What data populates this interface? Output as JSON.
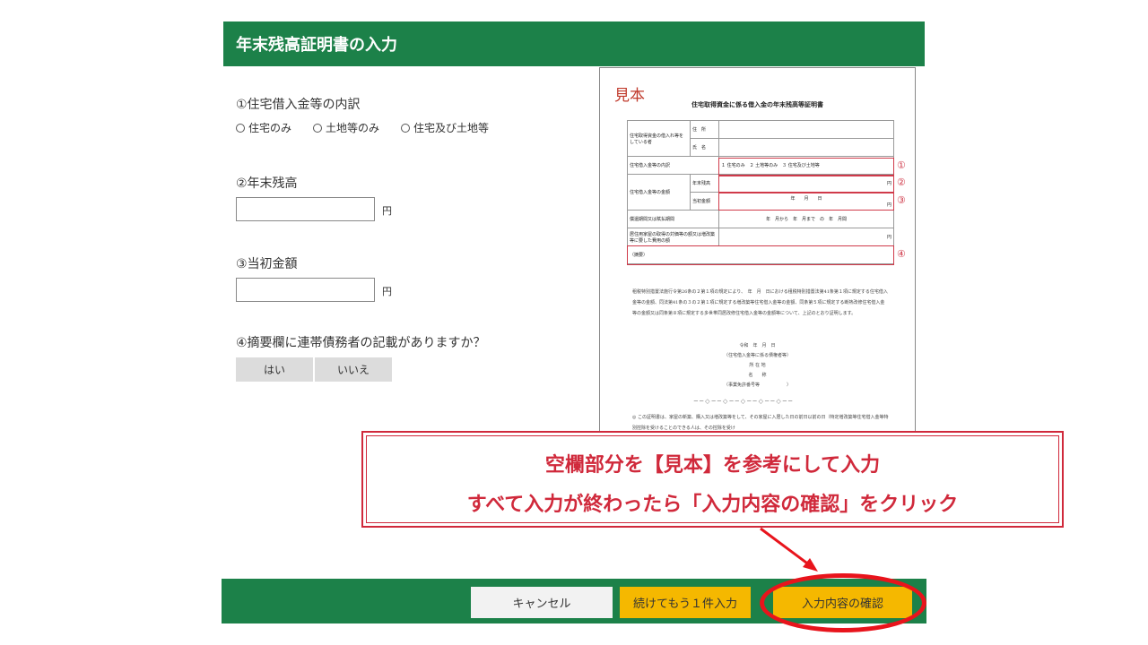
{
  "header": {
    "title": "年末残高証明書の入力"
  },
  "form": {
    "q1_label": "①住宅借入金等の内訳",
    "q1_options": [
      "住宅のみ",
      "土地等のみ",
      "住宅及び土地等"
    ],
    "q2_label": "②年末残高",
    "q3_label": "③当初金額",
    "yen": "円",
    "q4_label": "④摘要欄に連帯債務者の記載がありますか？",
    "yes": "はい",
    "no": "いいえ"
  },
  "sample": {
    "title": "見本",
    "heading": "住宅取得資金に係る借入金の年末残高等証明書",
    "r1_left": "住宅取得資金の借入れ等をしている者",
    "r1_a": "住　所",
    "r1_b": "氏　名",
    "r2_left": "住宅借入金等の内訳",
    "r2_val": "１ 住宅のみ　２ 土地等のみ　３ 住宅及び土地等",
    "r3_left": "住宅借入金等の金額",
    "r3_a": "年末残高",
    "r3_a_yen": "円",
    "r3_b": "当初金額",
    "r3_b_date": "年　　月　　日",
    "r3_b_yen": "円",
    "r4_left": "償還期間又は賦払期間",
    "r4_val": "年　月から　年　月まで　の　年　月間",
    "r5_left": "居住用家屋の取得の対価等の額又は増改築等に要した費用の額",
    "r5_yen": "円",
    "r6_left": "（摘要）",
    "marks": [
      "①",
      "②",
      "③",
      "④"
    ],
    "body": "租税特別措置法施行令第26条の２第１項の規定により、　年　月　日における租税特別措置法第41条第１項に規定する住宅借入金等の金額、同法第41条の３の２第１項に規定する増改築等住宅借入金等の金額、同条第５項に規定する断熱改修住宅借入金等の金額又は同条第８項に規定する多世帯同居改修住宅借入金等の金額等について、上記のとおり証明します。",
    "sign_date": "令和　年　月　日",
    "sign_org": "（住宅借入金等に係る債権者等）",
    "sign_addr": "所 在 地",
    "sign_name": "名　　称",
    "sign_code": "（事業免許番号等　　　　　　）",
    "divider": "──◇──◇──◇──◇──◇──",
    "note": "◎ この証明書は、家屋の新築、購入又は増改築等をして、その家屋に入居した日の前日以前の日（特定増改築等住宅借入金等特別控除を受けることのできる人は、その控除を受け"
  },
  "instruction": {
    "line1": "空欄部分を【見本】を参考にして入力",
    "line2": "すべて入力が終わったら「入力内容の確認」をクリック"
  },
  "footer": {
    "cancel": "キャンセル",
    "add_more": "続けてもう１件入力",
    "confirm": "入力内容の確認"
  },
  "colors": {
    "header_green": "#1c8149",
    "accent_yellow": "#f5b800",
    "annotation_red": "#d0293b"
  }
}
